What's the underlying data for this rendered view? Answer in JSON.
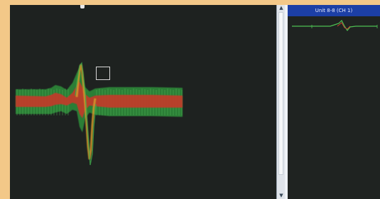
{
  "window": {
    "background_color": "#1f2321",
    "frame_color": "#f3c888"
  },
  "overview": {
    "header_title": "Unit 8-8 (CH 1)"
  },
  "waveform": {
    "colors": {
      "green_band": "#38a845",
      "red_band": "#c8382c",
      "spike": "#d8a030"
    }
  },
  "icons": {
    "scroll_up": "triangle-up-icon",
    "scroll_down": "triangle-down-icon"
  }
}
